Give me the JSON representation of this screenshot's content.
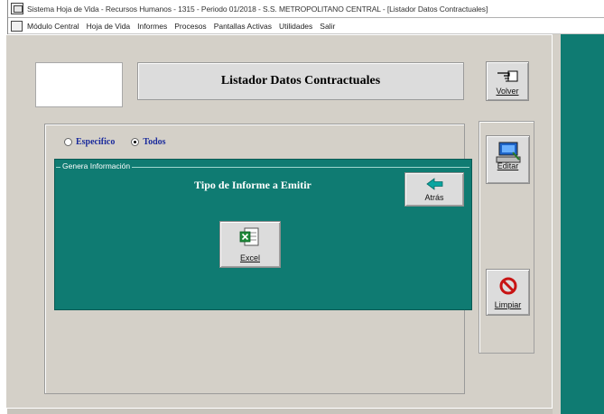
{
  "window": {
    "title": "Sistema Hoja de Vida - Recursos Humanos - 1315 - Periodo 01/2018 - S.S. METROPOLITANO CENTRAL - [Listador Datos Contractuales]"
  },
  "menu": {
    "items": [
      "Módulo Central",
      "Hoja de Vida",
      "Informes",
      "Procesos",
      "Pantallas Activas",
      "Utilidades",
      "Salir"
    ]
  },
  "header": {
    "title": "Listador Datos Contractuales"
  },
  "buttons": {
    "volver": "Volver",
    "editar": "Editar",
    "limpiar": "Limpiar"
  },
  "filter": {
    "options": [
      {
        "label": "Especifico",
        "selected": false
      },
      {
        "label": "Todos",
        "selected": true
      }
    ]
  },
  "dialog": {
    "legend": "Genera Información",
    "title": "Tipo de Informe a Emitir",
    "back_label": "Atrás",
    "excel_label": "Excel"
  },
  "colors": {
    "accent": "#0f7b72",
    "background": "#d4d0c8"
  }
}
